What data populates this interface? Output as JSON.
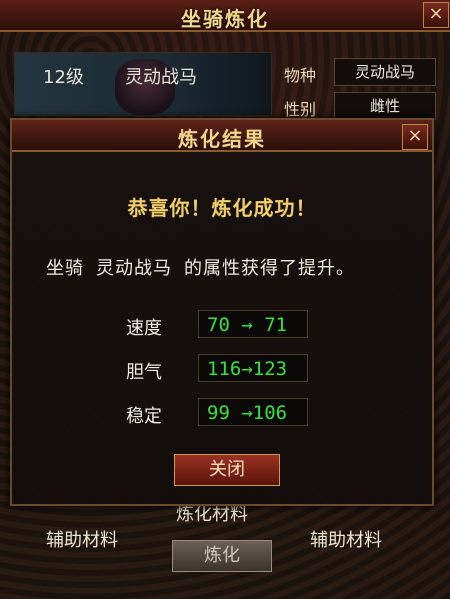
{
  "window": {
    "title": "坐骑炼化",
    "close_label": "×"
  },
  "mount": {
    "level": "12级",
    "name": "灵动战马"
  },
  "attributes": [
    {
      "label": "物种",
      "value": "灵动战马"
    },
    {
      "label": "性别",
      "value": "雌性"
    }
  ],
  "bottom": {
    "aux_left": "辅助材料",
    "refine_material": "炼化材料",
    "aux_right": "辅助材料",
    "refine_button": "炼化"
  },
  "dialog": {
    "title": "炼化结果",
    "close_label": "×",
    "success_message": "恭喜你！炼化成功！",
    "description": {
      "prefix": "坐骑",
      "mount_name": "灵动战马",
      "suffix": "的属性获得了提升。"
    },
    "stats": [
      {
        "label": "速度",
        "value": "70 → 71"
      },
      {
        "label": "胆气",
        "value": "116→123"
      },
      {
        "label": "稳定",
        "value": "99 →106"
      }
    ],
    "close_button": "关闭"
  }
}
